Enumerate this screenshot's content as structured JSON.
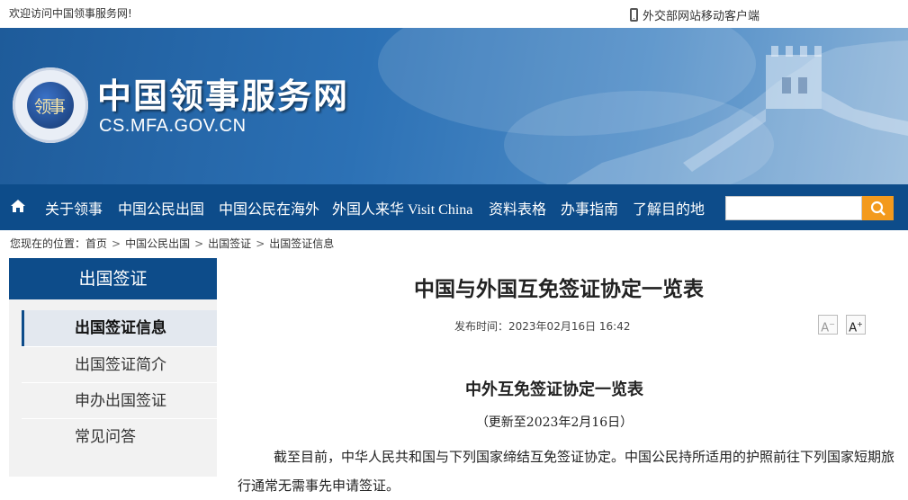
{
  "topbar": {
    "welcome": "欢迎访问中国领事服务网!",
    "mobile_link": "外交部网站移动客户端"
  },
  "banner": {
    "title": "中国领事服务网",
    "domain": "CS.MFA.GOV.CN",
    "emblem_text": "领事"
  },
  "nav": {
    "items": [
      "关于领事",
      "中国公民出国",
      "中国公民在海外",
      "外国人来华 Visit China",
      "资料表格",
      "办事指南",
      "了解目的地"
    ],
    "search_placeholder": ""
  },
  "breadcrumb": {
    "prefix": "您现在的位置：",
    "items": [
      "首页",
      "中国公民出国",
      "出国签证",
      "出国签证信息"
    ]
  },
  "sidebar": {
    "heading": "出国签证",
    "items": [
      {
        "label": "出国签证信息",
        "active": true
      },
      {
        "label": "出国签证简介",
        "active": false
      },
      {
        "label": "申办出国签证",
        "active": false
      },
      {
        "label": "常见问答",
        "active": false
      }
    ]
  },
  "article": {
    "title": "中国与外国互免签证协定一览表",
    "publish_label": "发布时间：",
    "publish_time": "2023年02月16日  16:42",
    "font_minus": "A",
    "font_plus": "A",
    "subtitle": "中外互免签证协定一览表",
    "updated": "（更新至2023年2月16日）",
    "paragraph": "截至目前，中华人民共和国与下列国家缔结互免签证协定。中国公民持所适用的护照前往下列国家短期旅行通常无需事先申请签证。"
  },
  "colors": {
    "nav_bg": "#0d4c8a",
    "search_button": "#f39a1d"
  },
  "icons": {
    "home": "home-icon",
    "search": "search-icon",
    "phone": "phone-icon"
  }
}
